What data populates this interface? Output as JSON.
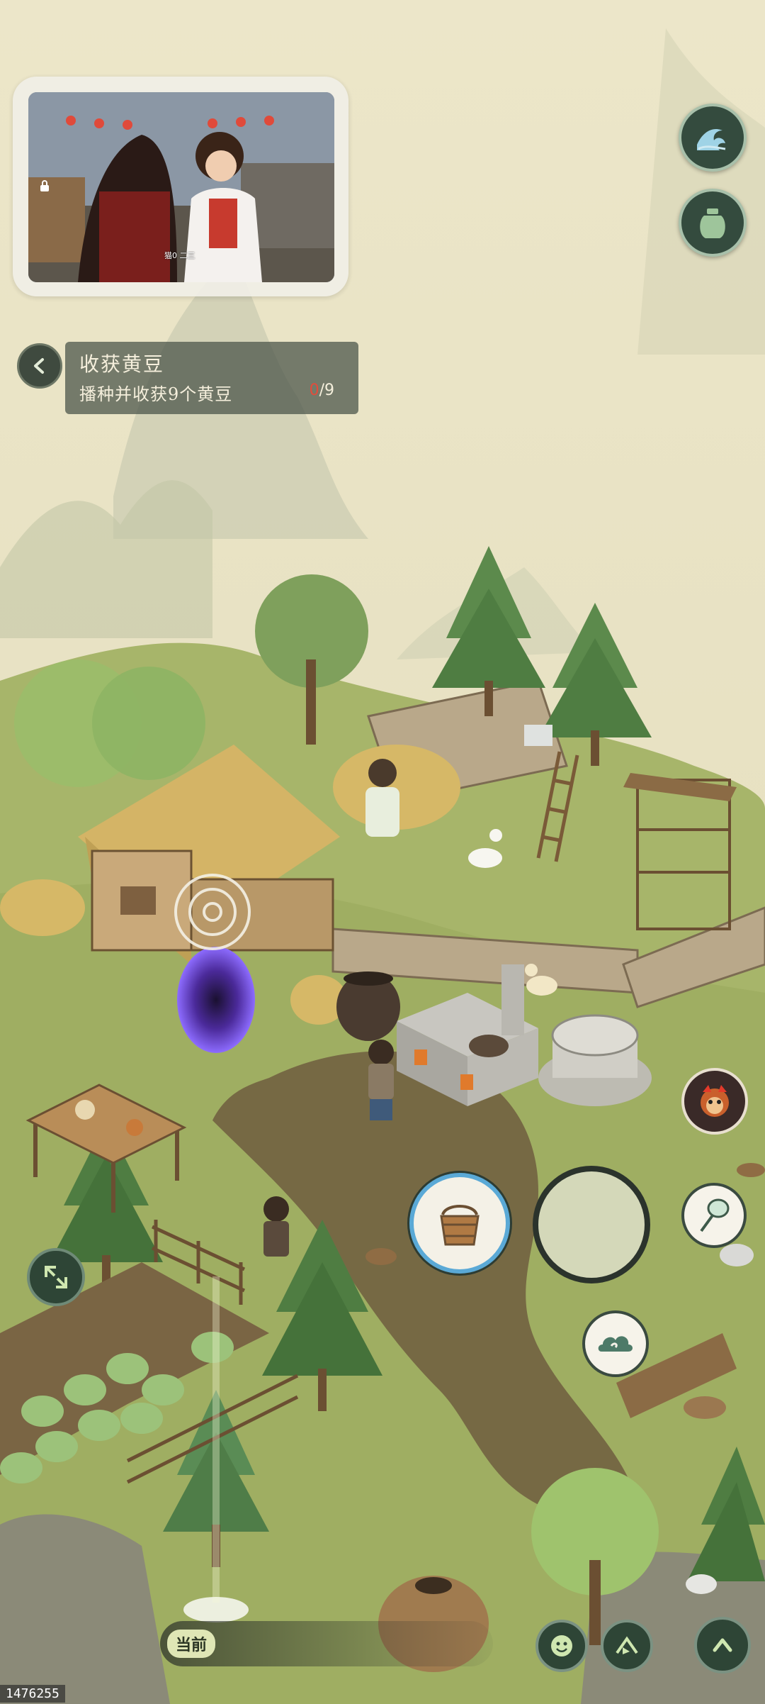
{
  "quest": {
    "title": "收获黄豆",
    "description": "播种并收获9个黄豆",
    "progress_current": "0",
    "progress_total": "/9"
  },
  "video_popup": {
    "caption": "猫0 二三"
  },
  "bottom_bar": {
    "current_label": "当前"
  },
  "device_id": "1476255",
  "icons": {
    "quest_back": "chevron-left-icon",
    "wave_button": "wave-icon",
    "jar_button": "jar-icon",
    "monkey_skill": "monkey-face-icon",
    "bucket_tool": "bucket-icon",
    "joystick": "joystick-icon",
    "net_tool": "net-icon",
    "cloud_skill": "cloud-icon",
    "expand_view": "expand-arrows-icon",
    "emote_button": "smile-icon",
    "fish_button": "fish-icon",
    "chevron_up": "chevron-up-icon"
  },
  "colors": {
    "progress_current": "#e44b3b",
    "button_dark": "#344b3e",
    "parchment": "#e9e3c6"
  }
}
